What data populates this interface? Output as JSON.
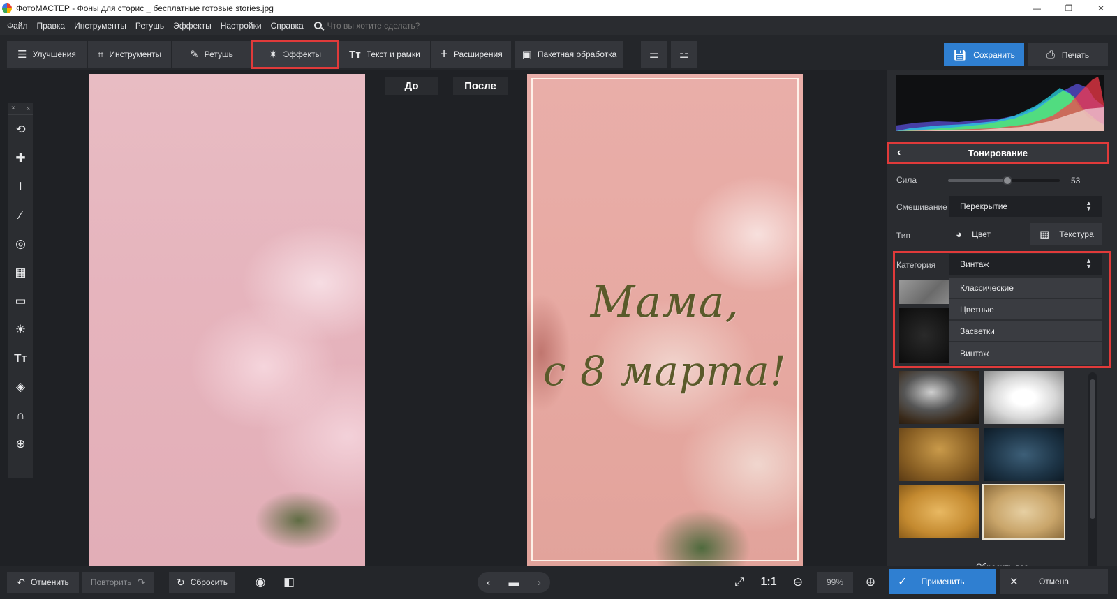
{
  "window": {
    "title": "ФотоМАСТЕР - Фоны для сторис _ бесплатные готовые stories.jpg",
    "minimize": "—",
    "restore": "❐",
    "close": "✕"
  },
  "menu": {
    "items": [
      "Файл",
      "Правка",
      "Инструменты",
      "Ретушь",
      "Эффекты",
      "Настройки",
      "Справка"
    ],
    "search_placeholder": "Что вы хотите сделать?"
  },
  "toolbar": {
    "tabs": [
      "Улучшения",
      "Инструменты",
      "Ретушь",
      "Эффекты",
      "Текст и рамки",
      "Расширения",
      "Пакетная обработка"
    ],
    "active_tab": "Эффекты",
    "save_label": "Сохранить",
    "print_label": "Печать"
  },
  "left_tools": {
    "close_glyph": "×",
    "collapse_glyph": "«"
  },
  "compare": {
    "before_label": "До",
    "after_label": "После",
    "greeting_line1": "Мама,",
    "greeting_line2": "с 8 марта!"
  },
  "panel": {
    "title": "Тонирование",
    "strength_label": "Сила",
    "strength_value": "53",
    "strength_fraction": 0.53,
    "blend_label": "Смешивание",
    "blend_value": "Перекрытие",
    "type_label": "Тип",
    "type_color": "Цвет",
    "type_texture": "Текстура",
    "category_label": "Категория",
    "category_value": "Винтаж",
    "category_options": [
      "Классические",
      "Цветные",
      "Засветки",
      "Винтаж"
    ],
    "reset_all": "Сбросить все"
  },
  "bottom": {
    "undo": "Отменить",
    "redo": "Повторить",
    "reset": "Сбросить",
    "zoom_ratio": "1:1",
    "zoom_value": "99%",
    "apply": "Применить",
    "cancel": "Отмена"
  },
  "colors": {
    "accent_blue": "#2f7fd1",
    "highlight_red": "#e03a3a",
    "panel_bg": "#2a2c30",
    "canvas_bg": "#1f2125"
  }
}
